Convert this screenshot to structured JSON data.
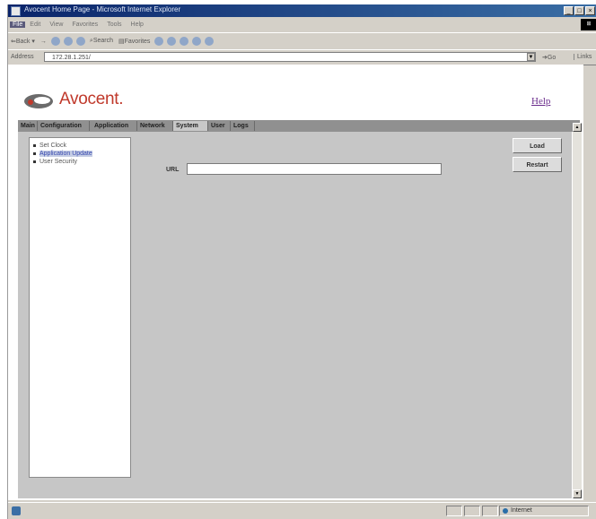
{
  "window": {
    "title": "Avocent Home Page - Microsoft Internet Explorer",
    "controls": [
      "_",
      "□",
      "×"
    ]
  },
  "menu": [
    "File",
    "Edit",
    "View",
    "Favorites",
    "Tools",
    "Help"
  ],
  "toolbar": {
    "back": "Back",
    "forward": "→",
    "search": "Search",
    "favorites": "Favorites"
  },
  "address": {
    "label": "Address",
    "value": "172.28.1.251/",
    "go": "Go",
    "links": "Links"
  },
  "brand": {
    "name": "Avocent.",
    "help": "Help"
  },
  "tabs": [
    {
      "label": "Main",
      "active": false
    },
    {
      "label": "Configuration",
      "active": false
    },
    {
      "label": "Application",
      "active": false
    },
    {
      "label": "Network",
      "active": false
    },
    {
      "label": "System",
      "active": true
    },
    {
      "label": "User",
      "active": false
    },
    {
      "label": "Logs",
      "active": false
    }
  ],
  "nav": [
    {
      "label": "Set Clock",
      "selected": false
    },
    {
      "label": "Application Update",
      "selected": true
    },
    {
      "label": "User Security",
      "selected": false
    }
  ],
  "form": {
    "url_label": "URL",
    "url_value": ""
  },
  "buttons": {
    "load": "Load",
    "restart": "Restart"
  },
  "status": {
    "zone": "Internet"
  }
}
